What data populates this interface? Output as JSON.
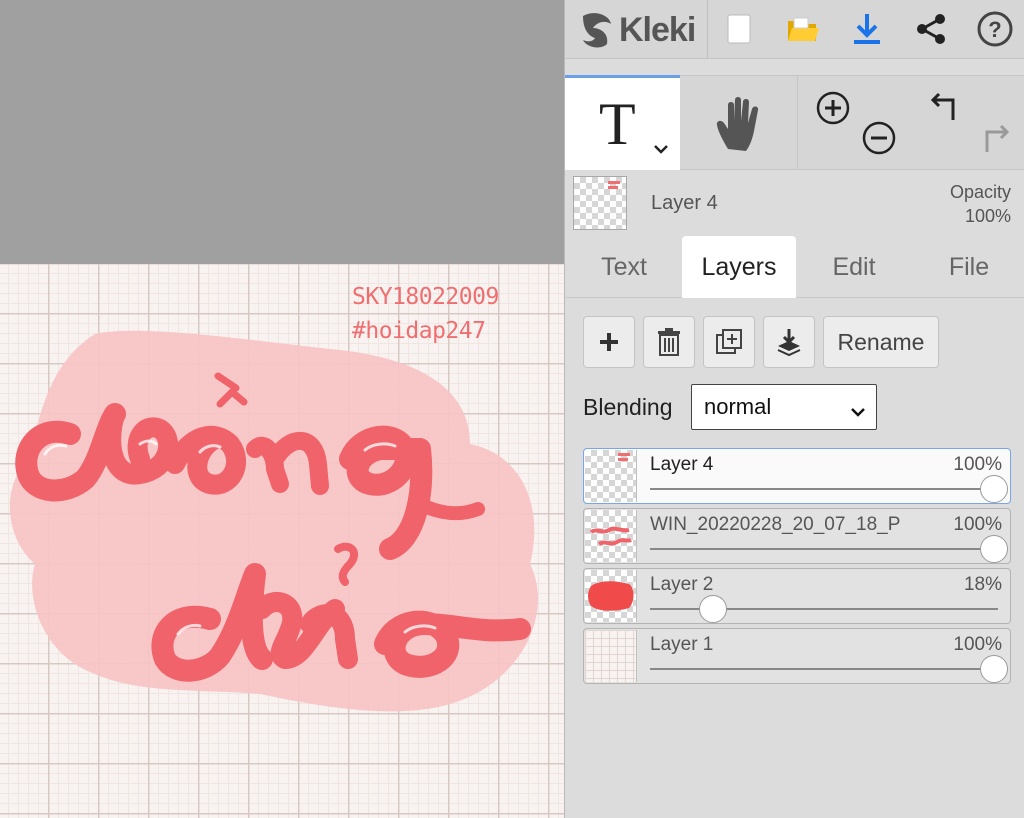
{
  "app": {
    "name": "Kleki"
  },
  "canvas": {
    "watermark_lines": [
      "SKY18022009",
      "#hoidap247"
    ],
    "colors": {
      "lettering": "#f0636a",
      "blob": "#f7c4c6",
      "paper": "#f8f3f1",
      "grid": "#d8c8c4"
    }
  },
  "toolbar": {
    "icons": [
      "new-image-icon",
      "open-folder-icon",
      "download-icon",
      "share-icon",
      "help-icon"
    ]
  },
  "tools": {
    "active": "text",
    "icons": [
      "text-tool-icon",
      "hand-tool-icon",
      "zoom-in-icon",
      "zoom-out-icon",
      "undo-icon",
      "redo-icon"
    ]
  },
  "current_layer": {
    "name": "Layer 4",
    "opacity_label": "Opacity",
    "opacity_value": "100%"
  },
  "tabs": [
    {
      "label": "Text",
      "active": false
    },
    {
      "label": "Layers",
      "active": true
    },
    {
      "label": "Edit",
      "active": false
    },
    {
      "label": "File",
      "active": false
    }
  ],
  "layers_panel": {
    "rename_label": "Rename",
    "blending_label": "Blending",
    "blending_value": "normal",
    "layers": [
      {
        "name": "Layer 4",
        "opacity": "100%",
        "opacity_value": 1.0,
        "selected": true
      },
      {
        "name": "WIN_20220228_20_07_18_P",
        "opacity": "100%",
        "opacity_value": 1.0,
        "selected": false
      },
      {
        "name": "Layer 2",
        "opacity": "18%",
        "opacity_value": 0.18,
        "selected": false
      },
      {
        "name": "Layer 1",
        "opacity": "100%",
        "opacity_value": 1.0,
        "selected": false
      }
    ]
  }
}
